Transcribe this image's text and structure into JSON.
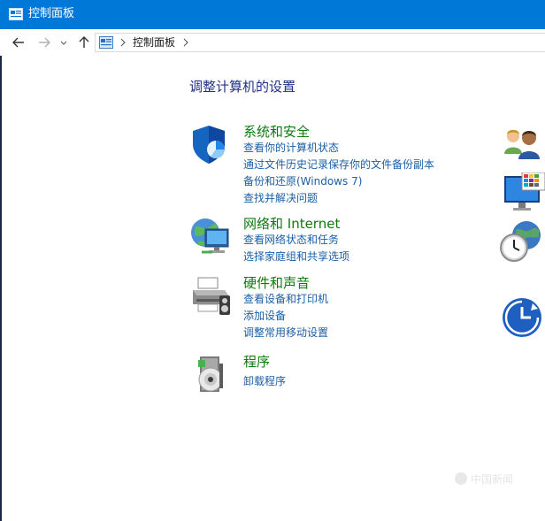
{
  "window": {
    "title": "控制面板",
    "title_icon": "control-panel-icon"
  },
  "navigation": {
    "back_icon": "arrow-left-icon",
    "forward_icon": "arrow-right-icon",
    "recent_icon": "chevron-down-icon",
    "up_icon": "arrow-up-icon"
  },
  "address_bar": {
    "icon": "control-panel-icon",
    "path": "控制面板"
  },
  "main": {
    "heading": "调整计算机的设置",
    "categories": [
      {
        "title": "系统和安全",
        "icon": "shield-icon",
        "links": [
          "查看你的计算机状态",
          "通过文件历史记录保存你的文件备份副本",
          "备份和还原(Windows 7)",
          "查找并解决问题"
        ]
      },
      {
        "title": "网络和 Internet",
        "icon": "network-globe-icon",
        "links": [
          "查看网络状态和任务",
          "选择家庭组和共享选项"
        ]
      },
      {
        "title": "硬件和声音",
        "icon": "printer-icon",
        "links": [
          "查看设备和打印机",
          "添加设备",
          "调整常用移动设置"
        ]
      },
      {
        "title": "程序",
        "icon": "programs-disc-icon",
        "links": [
          "卸载程序"
        ]
      }
    ],
    "right_column_icons": [
      "user-accounts-icon",
      "appearance-monitor-icon",
      "clock-globe-icon",
      "ease-of-access-icon"
    ]
  },
  "watermark": {
    "text": "中国新闻"
  },
  "colors": {
    "titlebar": "#0078d7",
    "heading": "#1e3287",
    "category_title": "#0e7a0d",
    "link": "#1a5fa8"
  }
}
